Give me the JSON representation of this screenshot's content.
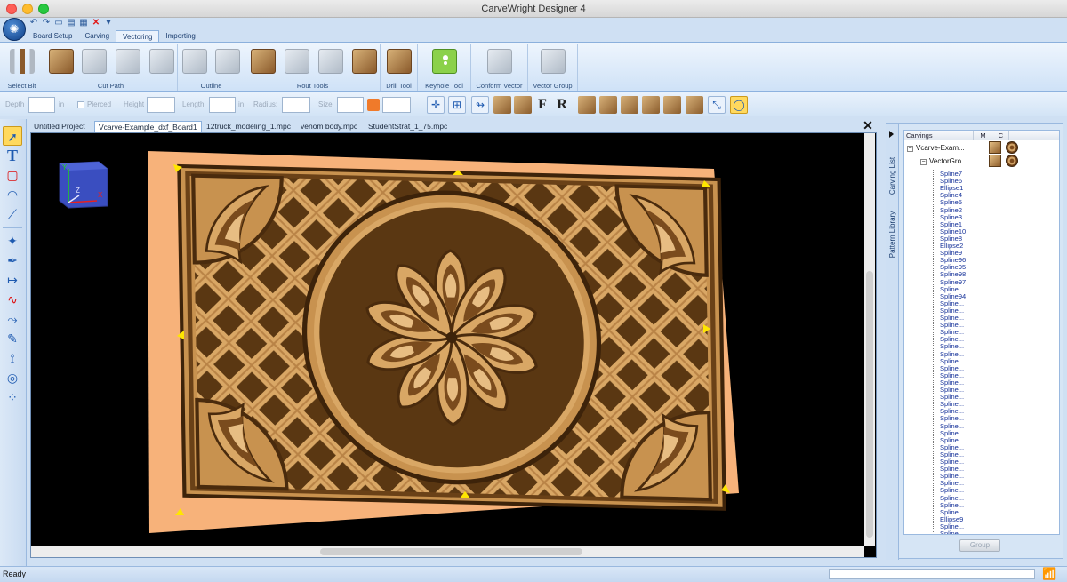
{
  "window": {
    "title": "CarveWright Designer 4"
  },
  "ribbon_tabs": [
    "Board Setup",
    "Carving",
    "Vectoring",
    "Importing"
  ],
  "ribbon_groups": {
    "select_bit": "Select Bit",
    "cut_path": "Cut Path",
    "outline": "Outline",
    "rout_tools": "Rout Tools",
    "drill_tool": "Drill Tool",
    "keyhole_tool": "Keyhole Tool",
    "conform_vector": "Conform Vector",
    "vector_group": "Vector Group"
  },
  "properties": {
    "depth_label": "Depth",
    "depth_unit": "in",
    "pierced_label": "Pierced",
    "height_label": "Height",
    "length_label": "Length",
    "length_unit": "in",
    "radius_label": "Radius:",
    "size_label": "Size"
  },
  "toolbar_text_buttons": {
    "f": "F",
    "r": "R"
  },
  "document_tabs": [
    "Untitled Project",
    "Vcarve-Example_dxf_Board1",
    "12truck_modeling_1.mpc",
    "venom body.mpc",
    "StudentStrat_1_75.mpc"
  ],
  "active_document": 1,
  "viewport": {
    "colors": {
      "board": "#f7b27a",
      "carving_light": "#d9a765",
      "carving_dark": "#5a3712",
      "background": "#000000"
    },
    "axis_labels": {
      "x": "X",
      "y": "Y",
      "z": "Z"
    }
  },
  "side_tabs": {
    "carving_list": "Carving List",
    "pattern_library": "Pattern Library"
  },
  "carvings_tree": {
    "columns": [
      "Carvings",
      "M",
      "C"
    ],
    "root": "Vcarve-Exam...",
    "group": "VectorGro...",
    "items": [
      "Spline7",
      "Spline6",
      "Ellipse1",
      "Spline4",
      "Spline5",
      "Spline2",
      "Spline3",
      "Spline1",
      "Spline10",
      "Spline8",
      "Ellipse2",
      "Spline9",
      "Spline96",
      "Spline95",
      "Spline98",
      "Spline97",
      "Spline...",
      "Spline94",
      "Spline...",
      "Spline...",
      "Spline...",
      "Spline...",
      "Spline...",
      "Spline...",
      "Spline...",
      "Spline...",
      "Spline...",
      "Spline...",
      "Spline...",
      "Spline...",
      "Spline...",
      "Spline...",
      "Spline...",
      "Spline...",
      "Spline...",
      "Spline...",
      "Spline...",
      "Spline...",
      "Spline...",
      "Spline...",
      "Spline...",
      "Spline...",
      "Spline...",
      "Spline...",
      "Spline...",
      "Spline...",
      "Spline...",
      "Spline...",
      "Ellipse9",
      "Spline...",
      "Spline..."
    ],
    "group_button": "Group"
  },
  "status": {
    "text": "Ready"
  }
}
